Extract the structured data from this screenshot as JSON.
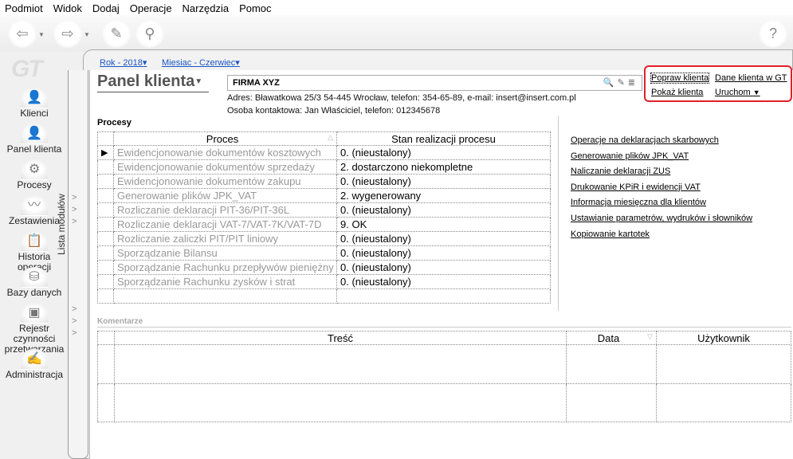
{
  "menu": [
    "Podmiot",
    "Widok",
    "Dodaj",
    "Operacje",
    "Narzędzia",
    "Pomoc"
  ],
  "logo": "GT",
  "sidebar": [
    {
      "label": "Klienci",
      "icon": "person-icon"
    },
    {
      "label": "Panel klienta",
      "icon": "person-card-icon"
    },
    {
      "label": "Procesy",
      "icon": "gears-icon"
    },
    {
      "label": "Zestawienia",
      "icon": "chart-icon"
    },
    {
      "label": "Historia operacji",
      "icon": "clipboard-icon"
    },
    {
      "label": "Bazy danych",
      "icon": "database-icon"
    },
    {
      "label": "Rejestr czynności przetwarzania",
      "icon": "id-card-icon"
    },
    {
      "label": "Administracja",
      "icon": "edit-icon"
    }
  ],
  "strip_label": "Lista modułów",
  "period": {
    "year": "Rok - 2018",
    "month": "Miesiac - Czerwiec"
  },
  "title": "Panel klienta",
  "client": {
    "name": "FIRMA XYZ",
    "address": "Adres: Bławatkowa 25/3 54-445 Wrocław, telefon: 354-65-89, e-mail: insert@insert.com.pl",
    "contact": "Osoba kontaktowa: Jan Właściciel, telefon: 012345678"
  },
  "actions": {
    "edit": "Popraw klienta",
    "gt": "Dane klienta w GT",
    "show": "Pokaż klienta",
    "run": "Uruchom"
  },
  "processes": {
    "label": "Procesy",
    "headers": [
      "Proces",
      "Stan realizacji procesu"
    ],
    "rows": [
      [
        "Ewidencjonowanie dokumentów kosztowych",
        "0. (nieustalony)"
      ],
      [
        "Ewidencjonowanie dokumentów sprzedaży",
        "2. dostarczono niekompletne"
      ],
      [
        "Ewidencjonowanie dokumentów zakupu",
        "0. (nieustalony)"
      ],
      [
        "Generowanie plików JPK_VAT",
        "2. wygenerowany"
      ],
      [
        "Rozliczanie deklaracji PIT-36/PIT-36L",
        "0. (nieustalony)"
      ],
      [
        "Rozliczanie deklaracji VAT-7/VAT-7K/VAT-7D",
        "9. OK"
      ],
      [
        "Rozliczanie zaliczki PIT/PIT liniowy",
        "0. (nieustalony)"
      ],
      [
        "Sporządzanie Bilansu",
        "0. (nieustalony)"
      ],
      [
        "Sporządzanie Rachunku przepływów pieniężny",
        "0. (nieustalony)"
      ],
      [
        "Sporządzanie Rachunku zysków i strat",
        "0. (nieustalony)"
      ]
    ]
  },
  "links": [
    "Operacje na deklaracjach skarbowych",
    "Generowanie plików JPK_VAT",
    "Naliczanie deklaracji ZUS",
    "Drukowanie KPiR i ewidencji VAT",
    "Informacja miesięczna dla klientów",
    "Ustawianie parametrów, wydruków i słowników",
    "Kopiowanie kartotek"
  ],
  "comments": {
    "label": "Komentarze",
    "headers": [
      "Treść",
      "Data",
      "Użytkownik"
    ]
  }
}
